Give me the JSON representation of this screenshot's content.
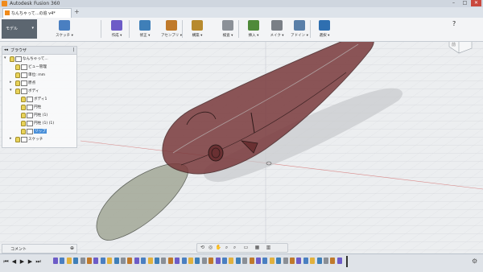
{
  "window": {
    "title": "Autodesk Fusion 360"
  },
  "tab": {
    "label": "なんちゃって...の追 v4*"
  },
  "toolbar": {
    "workspace": "モデル",
    "tools": [
      {
        "label": "スケッチ ▾",
        "icon": "sketch-icon",
        "color": "#4a7fc1"
      },
      {
        "label": "作成 ▾",
        "icon": "create-icon",
        "color": "#6d5cc7"
      },
      {
        "label": "修正 ▾",
        "icon": "modify-icon",
        "color": "#3f7fb8"
      },
      {
        "label": "アセンブリ ▾",
        "icon": "assemble-icon",
        "color": "#c07a2b"
      },
      {
        "label": "構築 ▾",
        "icon": "construct-icon",
        "color": "#b78a2e"
      },
      {
        "label": "検査 ▾",
        "icon": "inspect-icon",
        "color": "#8b9097"
      },
      {
        "label": "挿入 ▾",
        "icon": "insert-icon",
        "color": "#4f8a3a"
      },
      {
        "label": "メイク ▾",
        "icon": "make-icon",
        "color": "#7a7f86"
      },
      {
        "label": "アドイン ▾",
        "icon": "addins-icon",
        "color": "#5a7fa8"
      },
      {
        "label": "選択 ▾",
        "icon": "select-icon",
        "color": "#2f6fb0"
      }
    ]
  },
  "browser": {
    "title": "ブラウザ",
    "items": [
      {
        "label": "なんちゃって...",
        "level": 0,
        "twisty": "▾",
        "selected": false
      },
      {
        "label": "ビュー管理",
        "level": 1,
        "twisty": "",
        "selected": false
      },
      {
        "label": "単位: mm",
        "level": 1,
        "twisty": "",
        "selected": false
      },
      {
        "label": "原点",
        "level": 1,
        "twisty": "▸",
        "selected": false
      },
      {
        "label": "ボディ",
        "level": 1,
        "twisty": "▾",
        "selected": false
      },
      {
        "label": "ボディ1",
        "level": 2,
        "twisty": "",
        "selected": false
      },
      {
        "label": "円柱",
        "level": 2,
        "twisty": "",
        "selected": false
      },
      {
        "label": "円柱 (1)",
        "level": 2,
        "twisty": "",
        "selected": false
      },
      {
        "label": "円柱 (1) (1)",
        "level": 2,
        "twisty": "",
        "selected": false
      },
      {
        "label": "リップ",
        "level": 2,
        "twisty": "",
        "selected": true
      },
      {
        "label": "スケッチ",
        "level": 1,
        "twisty": "▸",
        "selected": false
      }
    ]
  },
  "comments": {
    "label": "コメント"
  },
  "viewcube": {
    "face": "前",
    "axis_label": "Z"
  },
  "colors": {
    "body": "#7a3a3c",
    "lip": "#9aa08f",
    "accent": "#2f6fb0"
  }
}
